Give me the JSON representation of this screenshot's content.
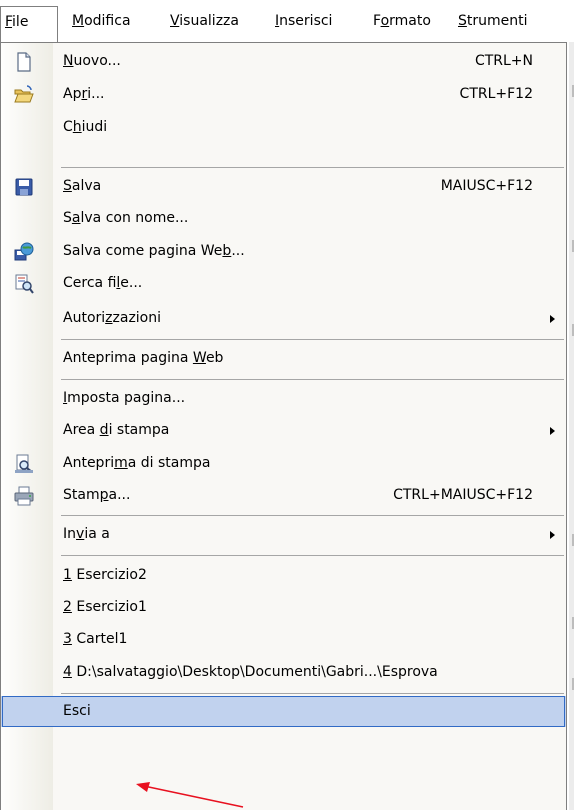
{
  "menubar": {
    "items": [
      {
        "before": "",
        "mnemonic": "F",
        "after": "ile"
      },
      {
        "before": "",
        "mnemonic": "M",
        "after": "odifica"
      },
      {
        "before": "",
        "mnemonic": "V",
        "after": "isualizza"
      },
      {
        "before": "",
        "mnemonic": "I",
        "after": "nserisci"
      },
      {
        "before": "F",
        "mnemonic": "o",
        "after": "rmato"
      },
      {
        "before": "",
        "mnemonic": "S",
        "after": "trumenti"
      }
    ]
  },
  "menu": {
    "items": [
      {
        "before": "",
        "mnemonic": "N",
        "after": "uovo...",
        "shortcut": "CTRL+N",
        "icon": "new-document-icon"
      },
      {
        "before": "Ap",
        "mnemonic": "r",
        "after": "i...",
        "shortcut": "CTRL+F12",
        "icon": "open-folder-icon"
      },
      {
        "before": "C",
        "mnemonic": "h",
        "after": "iudi",
        "shortcut": ""
      },
      {
        "before": "",
        "mnemonic": "S",
        "after": "alva",
        "shortcut": "MAIUSC+F12",
        "icon": "save-disk-icon"
      },
      {
        "before": "S",
        "mnemonic": "a",
        "after": "lva con nome...",
        "shortcut": ""
      },
      {
        "before": "Salva come pagina We",
        "mnemonic": "b",
        "after": "...",
        "shortcut": "",
        "icon": "save-as-web-icon"
      },
      {
        "before": "Cerca fi",
        "mnemonic": "l",
        "after": "e...",
        "shortcut": "",
        "icon": "file-search-icon"
      },
      {
        "before": "Autori",
        "mnemonic": "z",
        "after": "zazioni",
        "shortcut": "",
        "submenu": true
      },
      {
        "before": "Anteprima pagina ",
        "mnemonic": "W",
        "after": "eb",
        "shortcut": ""
      },
      {
        "before": "",
        "mnemonic": "I",
        "after": "mposta pagina...",
        "shortcut": ""
      },
      {
        "before": "Area ",
        "mnemonic": "d",
        "after": "i stampa",
        "shortcut": "",
        "submenu": true
      },
      {
        "before": "Antepri",
        "mnemonic": "m",
        "after": "a di stampa",
        "shortcut": "",
        "icon": "print-preview-icon"
      },
      {
        "before": "Stam",
        "mnemonic": "p",
        "after": "a...",
        "shortcut": "CTRL+MAIUSC+F12",
        "icon": "printer-icon"
      },
      {
        "before": "In",
        "mnemonic": "v",
        "after": "ia a",
        "shortcut": "",
        "submenu": true
      },
      {
        "before": "",
        "mnemonic": "1",
        "after": " Esercizio2",
        "shortcut": ""
      },
      {
        "before": "",
        "mnemonic": "2",
        "after": " Esercizio1",
        "shortcut": ""
      },
      {
        "before": "",
        "mnemonic": "3",
        "after": " Cartel1",
        "shortcut": ""
      },
      {
        "before": "",
        "mnemonic": "4",
        "after": " D:\\salvataggio\\Desktop\\Documenti\\Gabri...\\Esprova",
        "shortcut": ""
      },
      {
        "before": "Esci",
        "mnemonic": "",
        "after": "",
        "shortcut": ""
      }
    ]
  },
  "colors": {
    "highlight": "#c1d2ee",
    "highlight_border": "#316ac5",
    "annotation_arrow": "#e8101f"
  }
}
